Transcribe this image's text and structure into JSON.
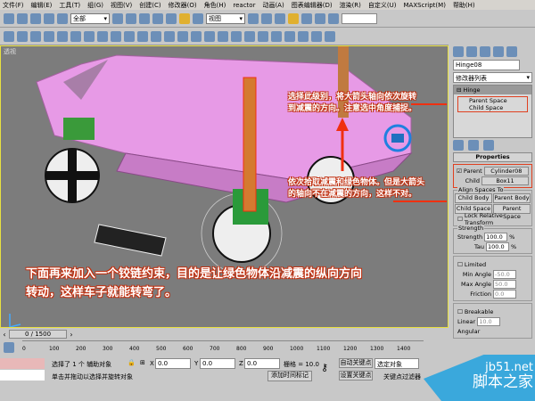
{
  "menu": [
    "文件(F)",
    "编辑(E)",
    "工具(T)",
    "组(G)",
    "视图(V)",
    "创建(C)",
    "修改器(O)",
    "角色(H)",
    "reactor",
    "动画(A)",
    "图表编辑器(D)",
    "渲染(R)",
    "自定义(U)",
    "MAXScript(M)",
    "帮助(H)"
  ],
  "toolbar": {
    "selection_filter": "全部",
    "ref_coord": "视图"
  },
  "viewport": {
    "label": "透视"
  },
  "annotations": {
    "a1_line1": "选择此级别，将大箭头轴向依次旋转",
    "a1_line2": "到减震的方向。注意选中角度捕捉。",
    "a2_line1": "依次拾取减震和绿色物体。但是大箭头",
    "a2_line2": "的轴向不在减震的方向，这样不对。",
    "main_line1": "下面再来加入一个铰链约束，目的是让绿色物体沿减震的纵向方向",
    "main_line2": "转动，这样车子就能转弯了。"
  },
  "panel": {
    "object_name": "Hinge08",
    "modifier_list": "修改器列表",
    "stack_root": "Hinge",
    "stack_items": [
      "Parent Space",
      "Child Space"
    ],
    "properties_title": "Properties",
    "parent_label": "Parent",
    "parent_value": "Cylinder08",
    "child_label": "Child",
    "child_value": "Box11",
    "align_title": "Align Spaces To",
    "align_buttons": [
      "Child Body",
      "Parent Body",
      "Child Space",
      "Parent Space"
    ],
    "lock_label": "Lock Relative Transform",
    "strength_title": "Strength",
    "strength_label": "Strength",
    "strength_value": "100.0",
    "tau_label": "Tau",
    "tau_value": "100.0",
    "pct": "%",
    "limited_label": "Limited",
    "min_angle_label": "Min Angle",
    "min_angle_value": "-50.0",
    "max_angle_label": "Max Angle",
    "max_angle_value": "50.0",
    "friction_label": "Friction",
    "friction_value": "0.0",
    "breakable_label": "Breakable",
    "linear_label": "Linear",
    "linear_value": "10.0",
    "angular_label": "Angular"
  },
  "timeline": {
    "frame": "0 / 1500",
    "ticks": [
      "0",
      "100",
      "200",
      "300",
      "400",
      "500",
      "600",
      "700",
      "800",
      "900",
      "1000",
      "1100",
      "1200",
      "1300",
      "1400"
    ]
  },
  "status": {
    "selected": "选择了 1 个 辅助对象",
    "prompt": "单击并拖动以选择并旋转对象",
    "x": "0.0",
    "y": "0.0",
    "z": "0.0",
    "grid": "栅格 = 10.0",
    "add_tag": "添加时间标记",
    "auto_key": "自动关键点",
    "set_key": "设置关键点",
    "sel_obj": "选定对象",
    "key_filter": "关键点过滤器"
  },
  "watermark": {
    "site": "jb51.net",
    "name": "脚本之家"
  }
}
